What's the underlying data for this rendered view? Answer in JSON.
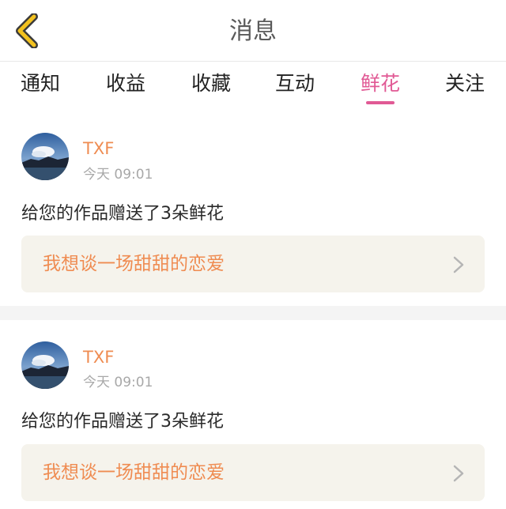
{
  "header": {
    "title": "消息",
    "back_icon": "chevron-left-icon",
    "accent_color": "#f3c21f"
  },
  "tabs": [
    {
      "label": "通知",
      "active": false
    },
    {
      "label": "收益",
      "active": false
    },
    {
      "label": "收藏",
      "active": false
    },
    {
      "label": "互动",
      "active": false
    },
    {
      "label": "鲜花",
      "active": true
    },
    {
      "label": "关注",
      "active": false
    }
  ],
  "active_color": "#e15a95",
  "messages": [
    {
      "username": "TXF",
      "time": "今天 09:01",
      "text": "给您的作品赠送了3朵鲜花",
      "work_title": "我想谈一场甜甜的恋爱"
    },
    {
      "username": "TXF",
      "time": "今天 09:01",
      "text": "给您的作品赠送了3朵鲜花",
      "work_title": "我想谈一场甜甜的恋爱"
    }
  ],
  "colors": {
    "username": "#ef8c52",
    "link_bg": "#f5f3ec",
    "timestamp": "#a8a8a8"
  }
}
